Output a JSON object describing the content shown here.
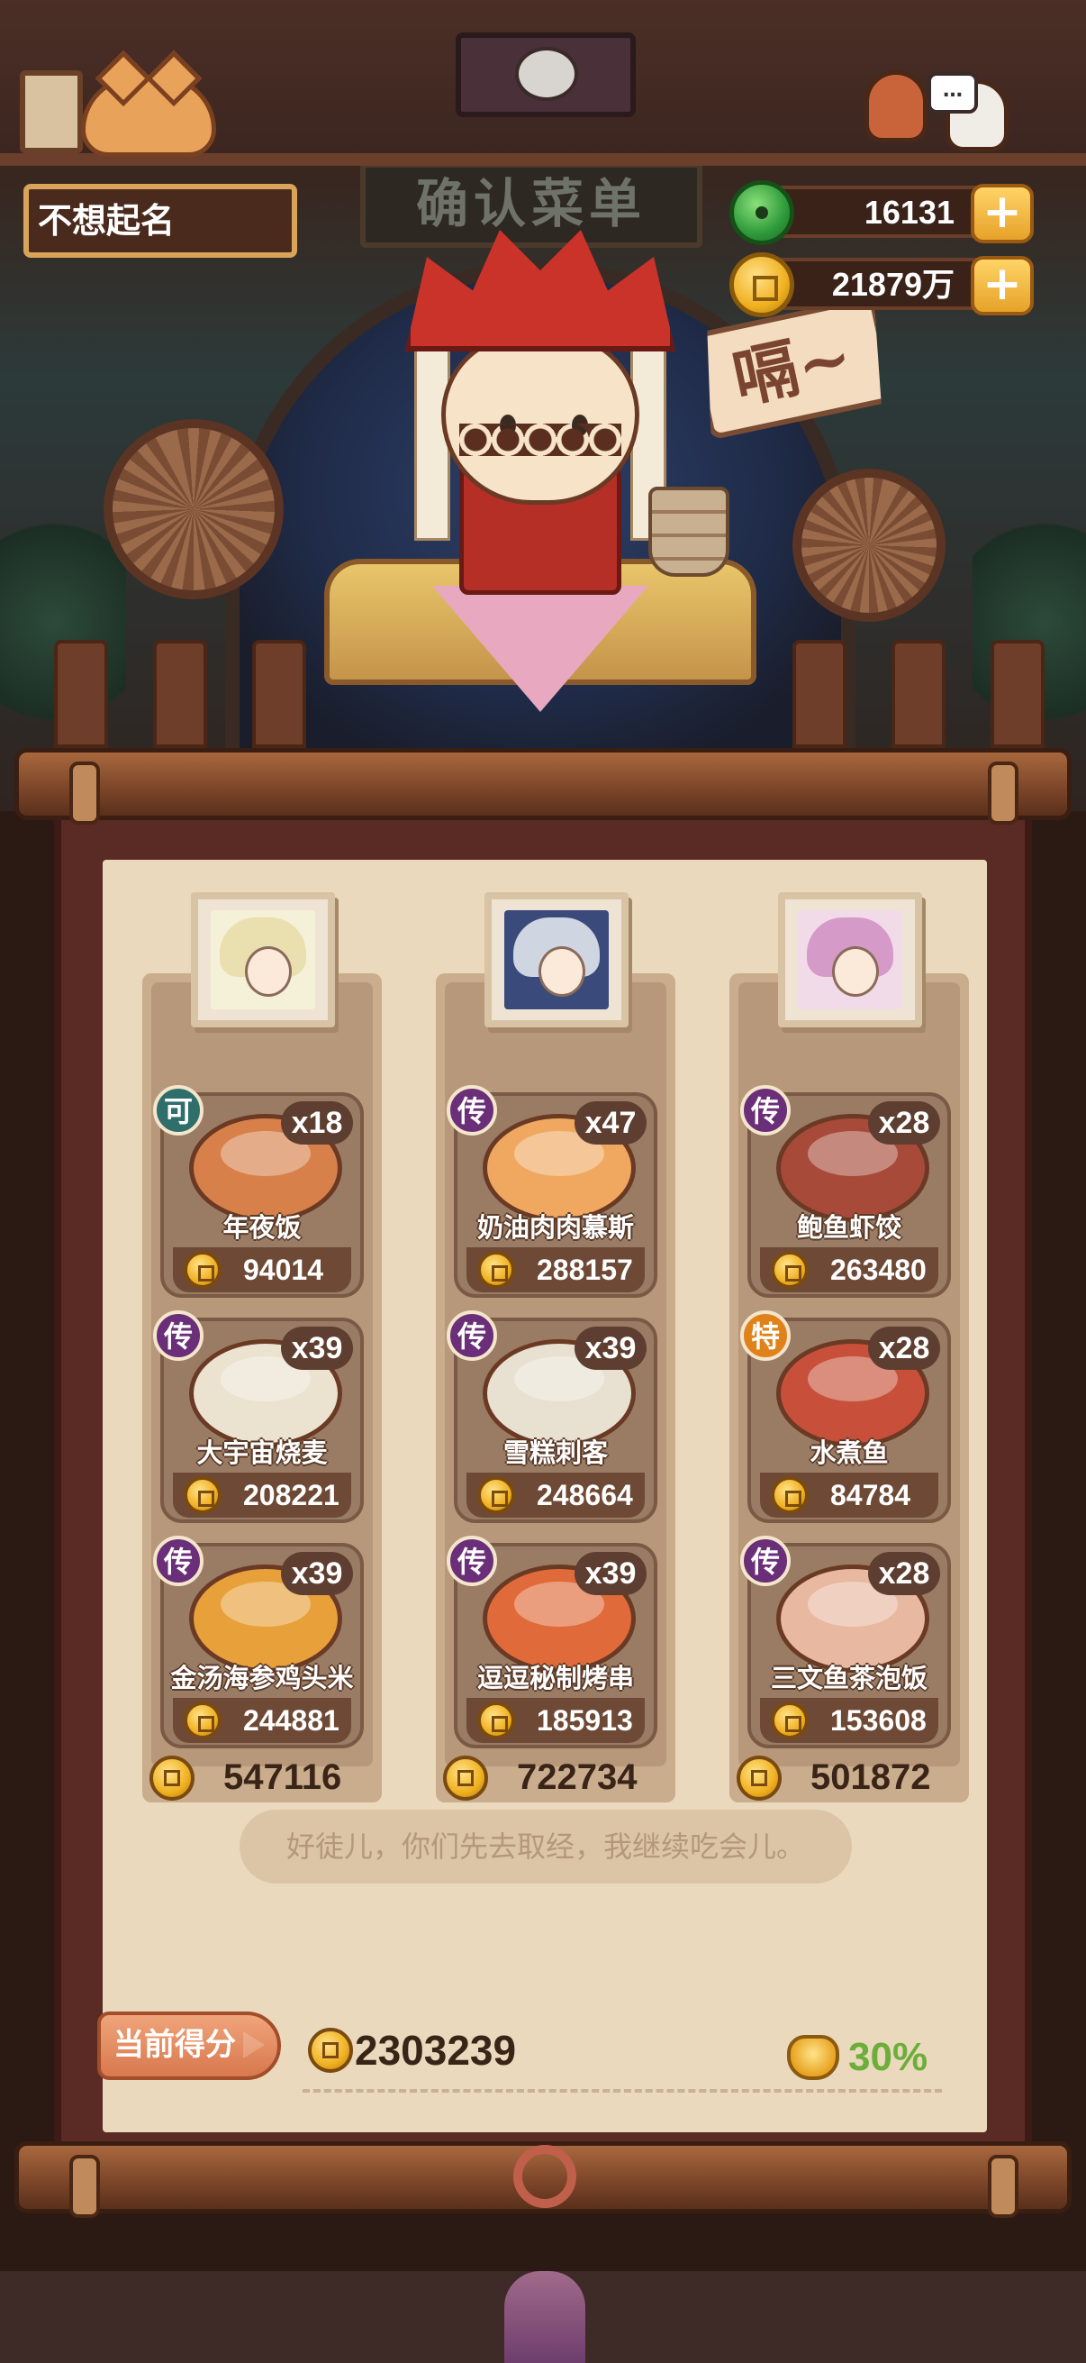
{
  "header": {
    "player_name": "不想起名",
    "shop_sign": "确认菜单",
    "currencies": [
      {
        "icon": "jade-icon",
        "value": "16131"
      },
      {
        "icon": "gold-coin-icon",
        "value": "21879万"
      }
    ],
    "speech_icon_text": "…"
  },
  "scene": {
    "bubble_text": "嗝~"
  },
  "columns": [
    {
      "portrait": "character-portrait-white-hair",
      "dishes": [
        {
          "badge": "可",
          "name": "年夜饭",
          "count": "x18",
          "price": "94014"
        },
        {
          "badge": "传",
          "name": "大宇宙烧麦",
          "count": "x39",
          "price": "208221"
        },
        {
          "badge": "传",
          "name": "金汤海参鸡头米",
          "count": "x39",
          "price": "244881"
        }
      ],
      "total": "547116"
    },
    {
      "portrait": "character-portrait-silver-hair",
      "dishes": [
        {
          "badge": "传",
          "name": "奶油肉肉慕斯",
          "count": "x47",
          "price": "288157"
        },
        {
          "badge": "传",
          "name": "雪糕刺客",
          "count": "x39",
          "price": "248664"
        },
        {
          "badge": "传",
          "name": "逗逗秘制烤串",
          "count": "x39",
          "price": "185913"
        }
      ],
      "total": "722734"
    },
    {
      "portrait": "character-portrait-pink-hair",
      "dishes": [
        {
          "badge": "传",
          "name": "鲍鱼虾饺",
          "count": "x28",
          "price": "263480"
        },
        {
          "badge": "特",
          "name": "水煮鱼",
          "count": "x28",
          "price": "84784"
        },
        {
          "badge": "传",
          "name": "三文鱼茶泡饭",
          "count": "x28",
          "price": "153608"
        }
      ],
      "total": "501872"
    }
  ],
  "quote": "好徒儿，你们先去取经，我继续吃会儿。",
  "score": {
    "label": "当前得分",
    "value": "2303239",
    "bonus": "30%"
  },
  "colors": {
    "legend_badge": "#6a2f78",
    "special_badge": "#e0821a",
    "ok_badge": "#2f6e6a",
    "bonus_text": "#6cae3a"
  }
}
